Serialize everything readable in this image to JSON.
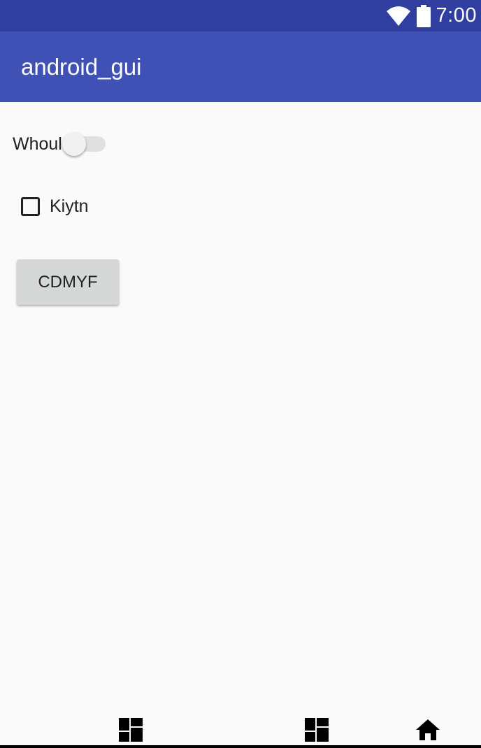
{
  "status_bar": {
    "time": "7:00",
    "icons": [
      "wifi-icon",
      "battery-icon"
    ]
  },
  "app_bar": {
    "title": "android_gui"
  },
  "content": {
    "switch": {
      "label": "Whoul",
      "checked": false
    },
    "checkbox": {
      "label": "Kiytn",
      "checked": false
    },
    "button": {
      "label": "CDMYF"
    }
  },
  "nav_bar": {
    "icons": [
      "dashboard-icon",
      "dashboard-icon",
      "home-icon"
    ]
  },
  "colors": {
    "status_bar": "#303f9f",
    "app_bar": "#3f51b5",
    "background": "#fafafa",
    "button": "#d6d7d7"
  }
}
